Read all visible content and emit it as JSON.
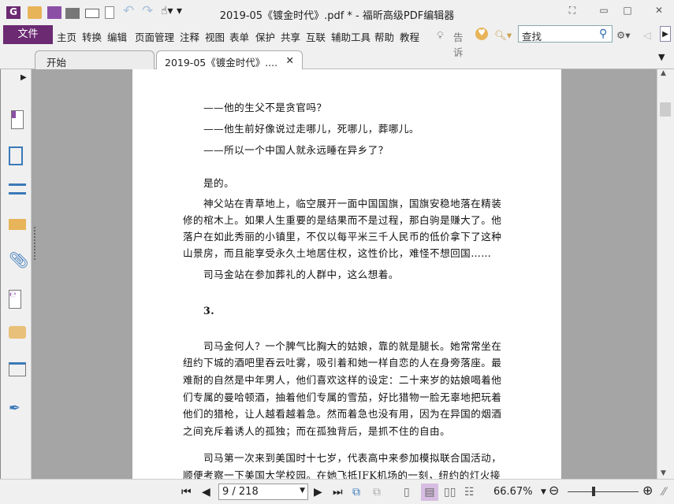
{
  "window": {
    "title": "2019-05《镀金时代》.pdf * - 福昕高级PDF编辑器"
  },
  "menu": {
    "file": "文件",
    "items": [
      "主页",
      "转换",
      "编辑",
      "页面管理",
      "注释",
      "视图",
      "表单",
      "保护",
      "共享",
      "互联",
      "辅助工具",
      "帮助",
      "教程"
    ],
    "tell_me": "告诉",
    "search_placeholder": "查找"
  },
  "tabs": [
    {
      "label": "开始"
    },
    {
      "label": "2019-05《镀金时代》...."
    }
  ],
  "document": {
    "lines": [
      "——他的生父不是贪官吗？",
      "——他生前好像说过走哪儿，死哪儿，葬哪儿。",
      "——所以一个中国人就永远睡在异乡了？",
      "是的。",
      "神父站在青草地上，临空展开一面中国国旗，国旗安稳地落在精装",
      "修的棺木上。如果人生重要的是结果而不是过程，那白驹是赚大了。他",
      "落户在如此秀丽的小镇里，不仅以每平米三千人民币的低价拿下了这种",
      "山景房，而且能享受永久土地居住权，这性价比，难怪不想回国……",
      "司马金站在参加葬礼的人群中，这么想着。",
      "3.",
      "司马金何人？一个脾气比胸大的姑娘，靠的就是腿长。她常常坐在",
      "纽约下城的酒吧里吞云吐雾，吸引着和她一样自恋的人在身旁落座。最",
      "难耐的自然是中年男人，他们喜欢这样的设定：二十来岁的姑娘喝着他",
      "们专属的曼哈顿酒，抽着他们专属的雪茄，好比猎物一脸无辜地把玩着",
      "他们的猎枪，让人越看越着急。然而着急也没有用，因为在异国的烟酒",
      "之间充斥着诱人的孤独；而在孤独背后，是抓不住的自由。",
      "司马第一次来到美国时十七岁，代表高中来参加模拟联合国活动，",
      "顺便考察一下美国大学校园。在她飞抵JFK机场的一刻，纽约的灯火接"
    ]
  },
  "status": {
    "page": "9 / 218",
    "zoom": "66.67%",
    "zoom_fraction": 0.6
  },
  "colors": {
    "brand": "#6b2a72"
  }
}
